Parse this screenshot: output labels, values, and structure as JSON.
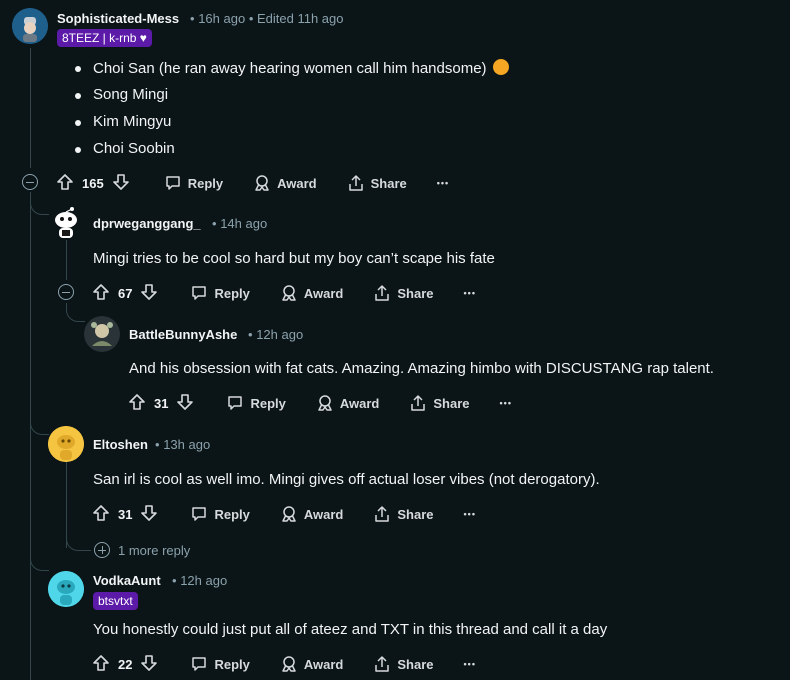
{
  "comments": [
    {
      "username": "Sophisticated-Mess",
      "time": "16h ago",
      "edited": "Edited 11h ago",
      "flair": "8TEEZ | k-rnb ♥",
      "bullets": [
        "Choi San (he ran away hearing women call him handsome)",
        "Song Mingi",
        "Kim Mingyu",
        "Choi Soobin"
      ],
      "votes": "165"
    },
    {
      "username": "dprweganggang_",
      "time": "14h ago",
      "text": "Mingi tries to be cool so hard but my boy can’t scape his fate",
      "votes": "67"
    },
    {
      "username": "BattleBunnyAshe",
      "time": "12h ago",
      "text": "And his obsession with fat cats. Amazing. Amazing himbo with DISCUSTANG rap talent.",
      "votes": "31"
    },
    {
      "username": "Eltoshen",
      "time": "13h ago",
      "text": "San irl is cool as well imo. Mingi gives off actual loser vibes (not derogatory).",
      "votes": "31"
    },
    {
      "username": "VodkaAunt",
      "time": "12h ago",
      "flair": "btsvtxt",
      "text": "You honestly could just put all of ateez and TXT in this thread and call it a day",
      "votes": "22"
    }
  ],
  "actions": {
    "reply": "Reply",
    "award": "Award",
    "share": "Share",
    "more": "•••"
  },
  "more_replies": "1 more reply",
  "separator": "•",
  "colors": {
    "background": "#0b1416",
    "flair": "#5b1aa8",
    "thread_line": "#33464c",
    "meta_text": "#8ba2ad"
  },
  "icons": {
    "upvote": "arrow-up-icon",
    "downvote": "arrow-down-icon",
    "reply": "speech-bubble-icon",
    "award": "award-ribbon-icon",
    "share": "share-arrow-icon",
    "collapse": "minus-circle-icon",
    "expand": "plus-circle-icon"
  }
}
